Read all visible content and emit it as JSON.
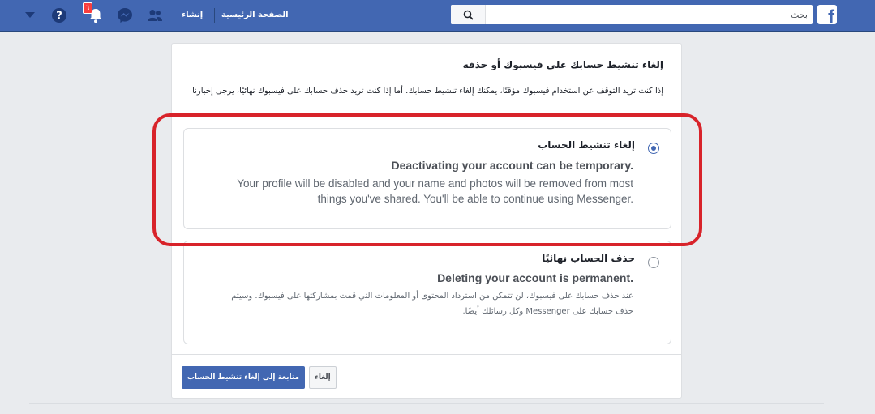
{
  "topbar": {
    "search_placeholder": "بحث",
    "nav_home": "الصفحة الرئيسية",
    "nav_create": "إنشاء",
    "notifications_count": "٦",
    "icons": [
      "facebook-logo-icon",
      "search-icon",
      "friends-icon",
      "messenger-icon",
      "notifications-icon",
      "help-icon",
      "menu-caret-icon"
    ],
    "brand_color": "#4267b2"
  },
  "card": {
    "title": "إلغاء تنشيط حسابك على فيسبوك أو حذفه",
    "intro": "إذا كنت تريد التوقف عن استخدام فيسبوك مؤقتًا، يمكنك إلغاء تنشيط حسابك. أما إذا كنت تريد حذف حسابك على فيسبوك نهائيًا، يرجى إخبارنا",
    "options": [
      {
        "title": "إلغاء تنشيط الحساب",
        "lead": "Deactivating your account can be temporary.",
        "description": "Your profile will be disabled and your name and photos will be removed from most things you've shared. You'll be able to continue using Messenger.",
        "selected": true
      },
      {
        "title": "حذف الحساب نهائيًا",
        "lead": "Deleting your account is permanent.",
        "description": "عند حذف حسابك على فيسبوك، لن تتمكن من استرداد المحتوى أو المعلومات التي قمت بمشاركتها على فيسبوك. وسيتم حذف حسابك على Messenger وكل رسائلك أيضًا.",
        "selected": false
      }
    ],
    "continue_button": "متابعة إلى إلغاء تنشيط الحساب",
    "cancel_button": "إلغاء"
  },
  "annotation": {
    "highlight_color": "#d8232a"
  }
}
